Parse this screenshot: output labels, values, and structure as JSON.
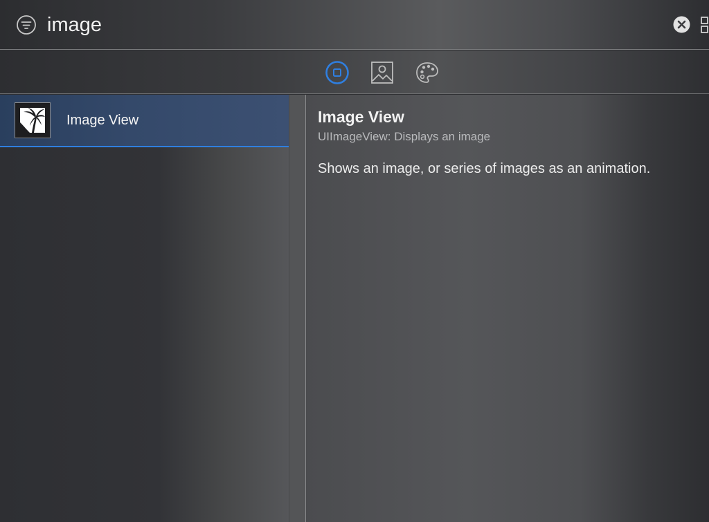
{
  "search": {
    "value": "image",
    "filter_icon": "filter-icon",
    "clear_icon": "clear-search-icon",
    "layout_icon": "grid-view-icon"
  },
  "tabs": [
    {
      "name": "objects",
      "icon": "object-square-icon",
      "selected": true
    },
    {
      "name": "media",
      "icon": "photo-icon",
      "selected": false
    },
    {
      "name": "colors",
      "icon": "palette-icon",
      "selected": false
    }
  ],
  "list": {
    "items": [
      {
        "label": "Image View",
        "icon": "image-view-thumbnail-icon",
        "selected": true
      }
    ]
  },
  "detail": {
    "title": "Image View",
    "subtitle": "UIImageView: Displays an image",
    "description": "Shows an image, or series of images as an animation."
  },
  "colors": {
    "accent": "#2f7fe0",
    "selection": "#34496a",
    "background": "#2f3033"
  }
}
